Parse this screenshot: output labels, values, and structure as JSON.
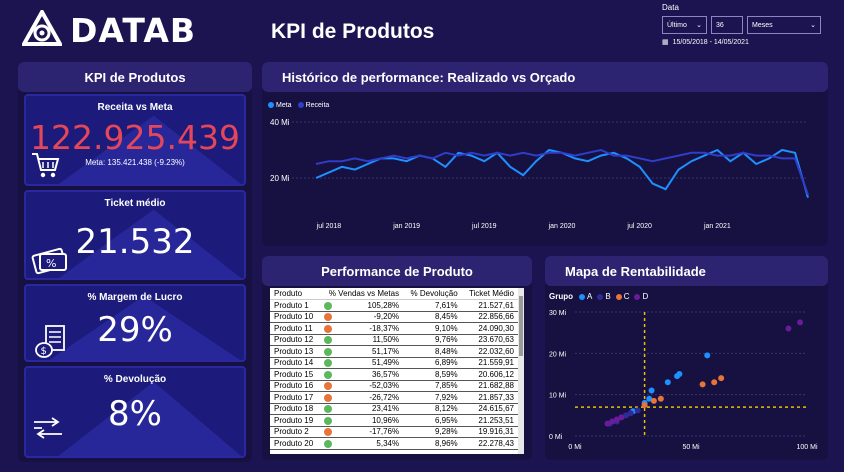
{
  "logo": {
    "text": "DATAB",
    "icon": "logo-mark-icon"
  },
  "page_title": "KPI de Produtos",
  "date_filter": {
    "label": "Data",
    "mode": "Último",
    "count": "36",
    "unit": "Meses",
    "range": "15/05/2018 - 14/05/2021"
  },
  "sidebar": {
    "header": "KPI de Produtos",
    "cards": [
      {
        "title": "Receita vs Meta",
        "value": "122.925.439",
        "sub": "Meta: 135.421.438 (-9.23%)",
        "icon": "shopping-cart-icon"
      },
      {
        "title": "Ticket médio",
        "value": "21.532",
        "icon": "tickets-icon"
      },
      {
        "title": "% Margem de Lucro",
        "value": "29%",
        "icon": "money-icon"
      },
      {
        "title": "% Devolução",
        "value": "8%",
        "icon": "return-arrows-icon"
      }
    ]
  },
  "history": {
    "header": "Histórico de performance: Realizado vs Orçado",
    "legend": [
      "Meta",
      "Receita"
    ],
    "colors": {
      "meta": "#1e90ff",
      "receita": "#2f3dc8"
    }
  },
  "performance": {
    "header": "Performance de Produto",
    "columns": [
      "Produto",
      "% Vendas vs Metas",
      "% Devolução",
      "Ticket Médio"
    ],
    "rows": [
      [
        "Produto 1",
        "105,28%",
        "7,61%",
        "21.527,61",
        "green"
      ],
      [
        "Produto 10",
        "-9,20%",
        "8,45%",
        "22.856,66",
        "orange"
      ],
      [
        "Produto 11",
        "-18,37%",
        "9,10%",
        "24.090,30",
        "orange"
      ],
      [
        "Produto 12",
        "11,50%",
        "9,76%",
        "23.670,63",
        "green"
      ],
      [
        "Produto 13",
        "51,17%",
        "8,48%",
        "22.032,60",
        "green"
      ],
      [
        "Produto 14",
        "51,49%",
        "6,89%",
        "21.559,91",
        "green"
      ],
      [
        "Produto 15",
        "36,57%",
        "8,59%",
        "20.606,12",
        "green"
      ],
      [
        "Produto 16",
        "-52,03%",
        "7,85%",
        "21.682,88",
        "orange"
      ],
      [
        "Produto 17",
        "-26,72%",
        "7,92%",
        "21.857,33",
        "orange"
      ],
      [
        "Produto 18",
        "23,41%",
        "8,12%",
        "24.615,67",
        "green"
      ],
      [
        "Produto 19",
        "10,96%",
        "6,95%",
        "21.253,51",
        "green"
      ],
      [
        "Produto 2",
        "-17,76%",
        "9,28%",
        "19.916,31",
        "orange"
      ],
      [
        "Produto 20",
        "5,34%",
        "8,96%",
        "22.278,43",
        "green"
      ]
    ]
  },
  "rentabilidade": {
    "header": "Mapa de Rentabilidade",
    "legend_title": "Grupo",
    "groups": [
      {
        "name": "A",
        "color": "#1e90ff"
      },
      {
        "name": "B",
        "color": "#2f2a9a"
      },
      {
        "name": "C",
        "color": "#e8743b"
      },
      {
        "name": "D",
        "color": "#6a1b9a"
      }
    ]
  },
  "chart_data": [
    {
      "type": "line",
      "title": "Histórico de performance: Realizado vs Orçado",
      "x_tick_labels": [
        "jul 2018",
        "jan 2019",
        "jul 2019",
        "jan 2020",
        "jul 2020",
        "jan 2021"
      ],
      "y_tick_labels": [
        "20 Mi",
        "40 Mi"
      ],
      "ylim": [
        10,
        40
      ],
      "x_start": "2018-06",
      "x_end": "2021-05",
      "series": [
        {
          "name": "Meta",
          "values": [
            20,
            22,
            24,
            23,
            25,
            27,
            27,
            26,
            28,
            27,
            24,
            29,
            28,
            26,
            29,
            24,
            21,
            26,
            30,
            29,
            27,
            26,
            28,
            29,
            27,
            24,
            18,
            16,
            23,
            26,
            28,
            30,
            26,
            29,
            25,
            27,
            30,
            29,
            13
          ]
        },
        {
          "name": "Receita",
          "values": [
            25,
            26,
            26,
            27,
            26,
            27,
            28,
            27,
            28,
            27,
            29,
            28,
            29,
            28,
            29,
            28,
            29,
            28,
            29,
            29,
            28,
            29,
            30,
            28,
            28,
            27,
            26,
            27,
            28,
            29,
            29,
            28,
            28,
            29,
            28,
            28,
            27,
            27,
            14
          ]
        }
      ]
    },
    {
      "type": "scatter",
      "title": "Mapa de Rentabilidade",
      "x_tick_labels": [
        "0 Mi",
        "50 Mi",
        "100 Mi"
      ],
      "y_tick_labels": [
        "0 Mi",
        "10 Mi",
        "20 Mi",
        "30 Mi"
      ],
      "xlim": [
        0,
        100
      ],
      "ylim": [
        0,
        30
      ],
      "reference_lines": {
        "x": 30,
        "y": 7
      },
      "series": [
        {
          "name": "A",
          "points": [
            [
              25,
              6
            ],
            [
              33,
              11
            ],
            [
              40,
              13
            ],
            [
              44,
              14.5
            ],
            [
              45,
              15
            ],
            [
              57,
              19.5
            ],
            [
              30,
              8
            ],
            [
              32,
              9
            ]
          ]
        },
        {
          "name": "B",
          "points": [
            [
              15,
              3
            ],
            [
              18,
              3.5
            ],
            [
              20,
              4.5
            ],
            [
              22,
              5
            ],
            [
              24,
              5.5
            ],
            [
              27,
              6.2
            ]
          ]
        },
        {
          "name": "C",
          "points": [
            [
              30,
              7.5
            ],
            [
              34,
              8.5
            ],
            [
              37,
              9
            ],
            [
              55,
              12.5
            ],
            [
              60,
              13
            ],
            [
              63,
              14
            ]
          ]
        },
        {
          "name": "D",
          "points": [
            [
              14,
              3
            ],
            [
              16,
              3.5
            ],
            [
              18,
              4
            ],
            [
              20,
              4.5
            ],
            [
              92,
              26
            ],
            [
              97,
              27.5
            ]
          ]
        }
      ]
    }
  ]
}
